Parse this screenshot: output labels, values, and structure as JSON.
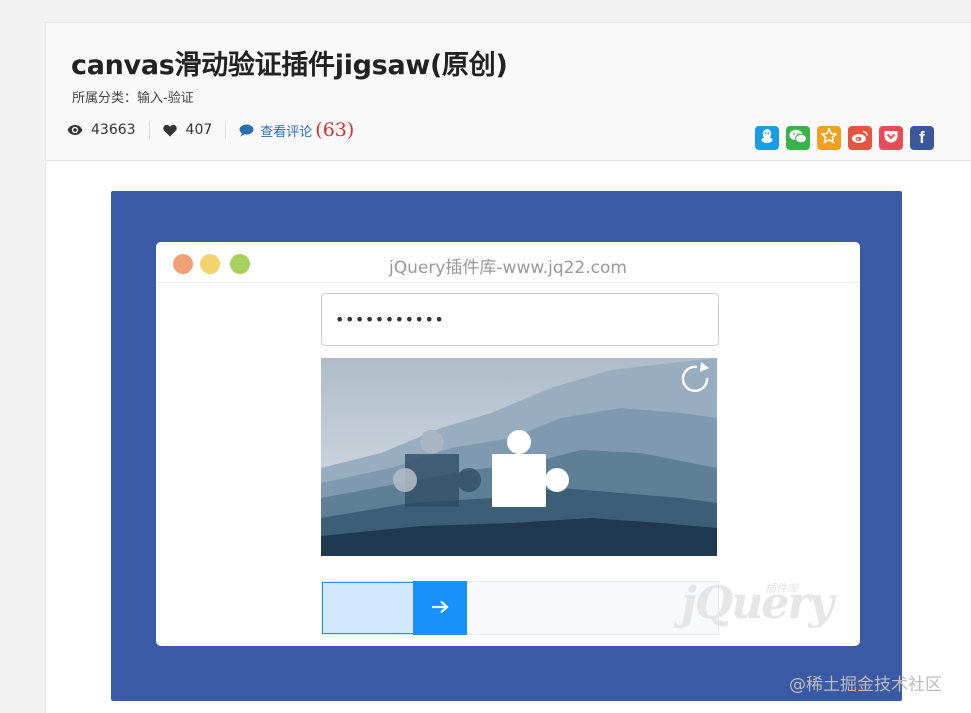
{
  "article": {
    "title": "canvas滑动验证插件jigsaw(原创)",
    "category": "所属分类：输入-验证",
    "views": "43663",
    "likes": "407",
    "comments_label": "查看评论",
    "comments_count": "(63)"
  },
  "share": {
    "buttons": [
      {
        "name": "qq",
        "icon": "qq-icon",
        "color": "#1a9be6"
      },
      {
        "name": "wechat",
        "icon": "wechat-icon",
        "color": "#37b34a"
      },
      {
        "name": "qzone",
        "icon": "qzone-star-icon",
        "color": "#f0a01c"
      },
      {
        "name": "weibo",
        "icon": "weibo-icon",
        "color": "#e6533e"
      },
      {
        "name": "pocket",
        "icon": "pocket-icon",
        "color": "#e84c57"
      },
      {
        "name": "facebook",
        "icon": "facebook-icon",
        "color": "#3b5998",
        "glyph": "f"
      }
    ]
  },
  "demo": {
    "browser_title": "jQuery插件库-www.jq22.com",
    "password_value": "•••••••••••",
    "slider_progress": 0.23,
    "watermark": "jQuery",
    "watermark_small": "插件库"
  },
  "colors": {
    "panel": "#3a5aa6",
    "dot_red": "#f0a078",
    "dot_yellow": "#f5d270",
    "dot_green": "#a7d15e",
    "slider_accent": "#1991fa",
    "slider_fill": "#d1e9fe"
  },
  "footer": {
    "watermark": "@稀土掘金技术社区"
  }
}
